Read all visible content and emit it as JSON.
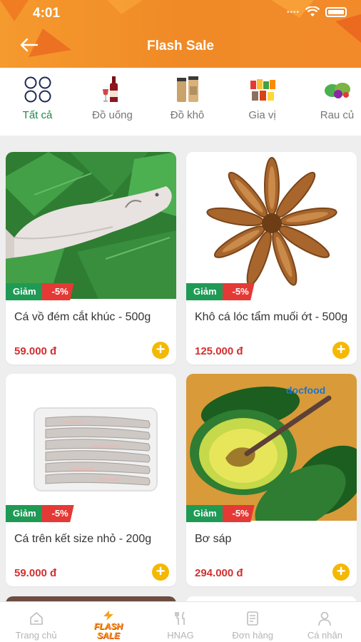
{
  "status_bar": {
    "time": "4:01"
  },
  "header": {
    "title": "Flash Sale"
  },
  "categories": [
    {
      "label": "Tất cả",
      "icon": "grid-icon",
      "active": true
    },
    {
      "label": "Đồ uống",
      "icon": "wine-bottle-icon"
    },
    {
      "label": "Đồ khô",
      "icon": "jars-icon"
    },
    {
      "label": "Gia vị",
      "icon": "spices-icon"
    },
    {
      "label": "Rau củ",
      "icon": "vegetables-icon"
    }
  ],
  "products": [
    {
      "name": "Cá vồ đém cắt khúc - 500g",
      "price": "59.000 đ",
      "badge": "Giảm",
      "discount": "-5%"
    },
    {
      "name": "Khô cá lóc tẩm muối ớt - 500g",
      "price": "125.000 đ",
      "badge": "Giảm",
      "discount": "-5%"
    },
    {
      "name": "Cá trên kết size nhỏ - 200g",
      "price": "59.000 đ",
      "badge": "Giảm",
      "discount": "-5%"
    },
    {
      "name": "Bơ sáp",
      "price": "294.000 đ",
      "badge": "Giảm",
      "discount": "-5%",
      "watermark": "docfood"
    }
  ],
  "tabbar": {
    "home": "Trang chủ",
    "flash": "FLASH SALE",
    "hnag": "HNAG",
    "orders": "Đơn hàng",
    "profile": "Cá nhân"
  },
  "colors": {
    "header": "#f08a26",
    "green": "#1f9a55",
    "red": "#e53935",
    "price": "#d32f2f",
    "add": "#f5b800"
  }
}
